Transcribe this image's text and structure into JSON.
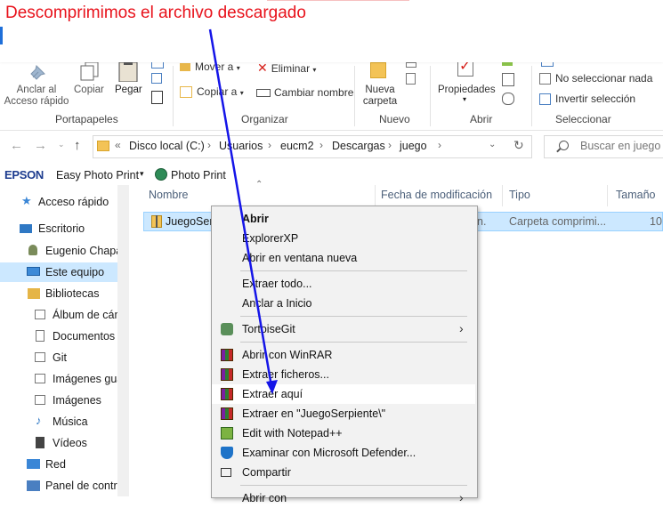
{
  "annotation": {
    "text": "Descomprimimos el archivo descargado"
  },
  "ribbon": {
    "portapapeles": {
      "anclar": "Anclar al Acceso rápido",
      "copiar": "Copiar",
      "pegar": "Pegar",
      "group": "Portapapeles"
    },
    "organizar": {
      "mover": "Mover a",
      "eliminar": "Eliminar",
      "copiar_a": "Copiar a",
      "cambiar": "Cambiar nombre",
      "group": "Organizar"
    },
    "nuevo": {
      "carpeta": "Nueva carpeta",
      "group": "Nuevo"
    },
    "abrir": {
      "propiedades": "Propiedades",
      "group": "Abrir"
    },
    "seleccionar": {
      "ninguno": "No seleccionar nada",
      "invertir": "Invertir selección",
      "group": "Seleccionar"
    }
  },
  "address": {
    "prefix": "«",
    "crumbs": [
      "Disco local (C:)",
      "Usuarios",
      "eucm2",
      "Descargas",
      "juego"
    ],
    "search_placeholder": "Buscar en juego"
  },
  "epson": {
    "brand": "EPSON",
    "easy": "Easy Photo Print",
    "photo": "Photo Print"
  },
  "nav": {
    "items": [
      "Acceso rápido",
      "Escritorio",
      "Eugenio Chapa",
      "Este equipo",
      "Bibliotecas",
      "Álbum de cám",
      "Documentos",
      "Git",
      "Imágenes gua",
      "Imágenes",
      "Música",
      "Vídeos",
      "Red",
      "Panel de contro"
    ]
  },
  "columns": {
    "nombre": "Nombre",
    "fecha": "Fecha de modificación",
    "tipo": "Tipo",
    "tamano": "Tamaño"
  },
  "file": {
    "name": "JuegoSerpie",
    "date_frag": "n.",
    "type": "Carpeta comprimi...",
    "size": "10"
  },
  "context_menu": {
    "abrir": "Abrir",
    "explorerxp": "ExplorerXP",
    "abrir_ventana": "Abrir en ventana nueva",
    "extraer_todo": "Extraer todo...",
    "anclar_inicio": "Anclar a Inicio",
    "tortoise": "TortoiseGit",
    "winrar": "Abrir con WinRAR",
    "extraer_ficheros": "Extraer ficheros...",
    "extraer_aqui": "Extraer aquí",
    "extraer_en": "Extraer en \"JuegoSerpiente\\\"",
    "notepad": "Edit with Notepad++",
    "defender": "Examinar con Microsoft Defender...",
    "compartir": "Compartir",
    "abrir_con": "Abrir con"
  }
}
